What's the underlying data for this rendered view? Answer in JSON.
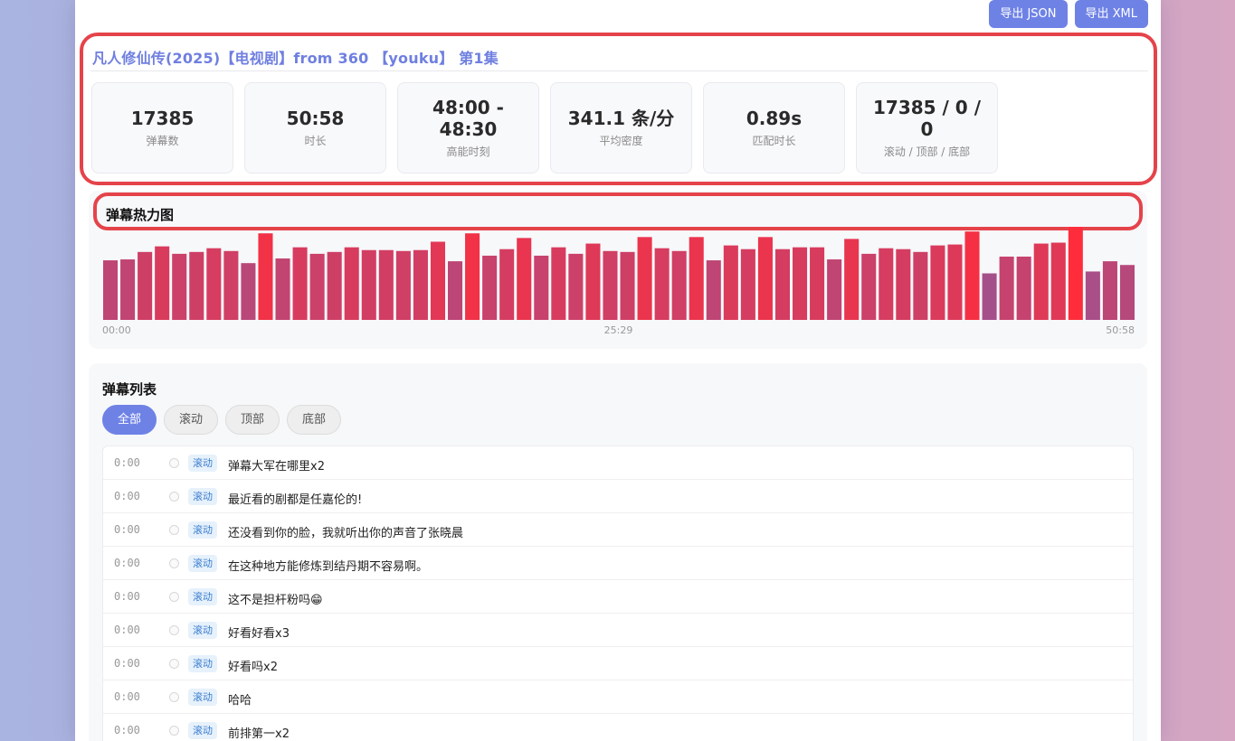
{
  "export": {
    "json_label": "导出 JSON",
    "xml_label": "导出 XML"
  },
  "info": {
    "title": "凡人修仙传(2025)【电视剧】from 360 【youku】 第1集",
    "stats": [
      {
        "value": "17385",
        "label": "弹幕数"
      },
      {
        "value": "50:58",
        "label": "时长"
      },
      {
        "value": "48:00 - 48:30",
        "label": "高能时刻"
      },
      {
        "value": "341.1 条/分",
        "label": "平均密度"
      },
      {
        "value": "0.89s",
        "label": "匹配时长"
      },
      {
        "value": "17385 / 0 / 0",
        "label": "滚动 / 顶部 / 底部"
      }
    ]
  },
  "heatmap": {
    "title": "弹幕热力图",
    "ticks": {
      "start": "00:00",
      "mid": "25:29",
      "end": "50:58"
    }
  },
  "list": {
    "title": "弹幕列表",
    "filters": [
      "全部",
      "滚动",
      "顶部",
      "底部"
    ],
    "rows": [
      {
        "time": "0:00",
        "tag": "滚动",
        "text": "弹幕大军在哪里x2"
      },
      {
        "time": "0:00",
        "tag": "滚动",
        "text": "最近看的剧都是任嘉伦的!"
      },
      {
        "time": "0:00",
        "tag": "滚动",
        "text": "还没看到你的脸，我就听出你的声音了张晓晨"
      },
      {
        "time": "0:00",
        "tag": "滚动",
        "text": "在这种地方能修炼到结丹期不容易啊。"
      },
      {
        "time": "0:00",
        "tag": "滚动",
        "text": "这不是担杆粉吗😁"
      },
      {
        "time": "0:00",
        "tag": "滚动",
        "text": "好看好看x3"
      },
      {
        "time": "0:00",
        "tag": "滚动",
        "text": "好看吗x2"
      },
      {
        "time": "0:00",
        "tag": "滚动",
        "text": "哈哈"
      },
      {
        "time": "0:00",
        "tag": "滚动",
        "text": "前排第一x2"
      }
    ]
  },
  "chart_data": {
    "type": "bar",
    "title": "弹幕热力图",
    "xlabel": "",
    "ylabel": "",
    "x_tick_labels": [
      "00:00",
      "25:29",
      "50:58"
    ],
    "values": [
      64,
      65,
      73,
      79,
      71,
      73,
      77,
      74,
      61,
      93,
      66,
      78,
      71,
      73,
      78,
      75,
      75,
      74,
      75,
      84,
      63,
      93,
      69,
      76,
      88,
      69,
      78,
      71,
      82,
      74,
      73,
      89,
      77,
      74,
      89,
      64,
      80,
      76,
      89,
      76,
      78,
      78,
      65,
      87,
      71,
      77,
      76,
      73,
      80,
      81,
      95,
      50,
      68,
      68,
      82,
      83,
      100,
      52,
      63,
      59
    ],
    "color_low": "#a54f8a",
    "color_high": "#ff2d3c"
  }
}
